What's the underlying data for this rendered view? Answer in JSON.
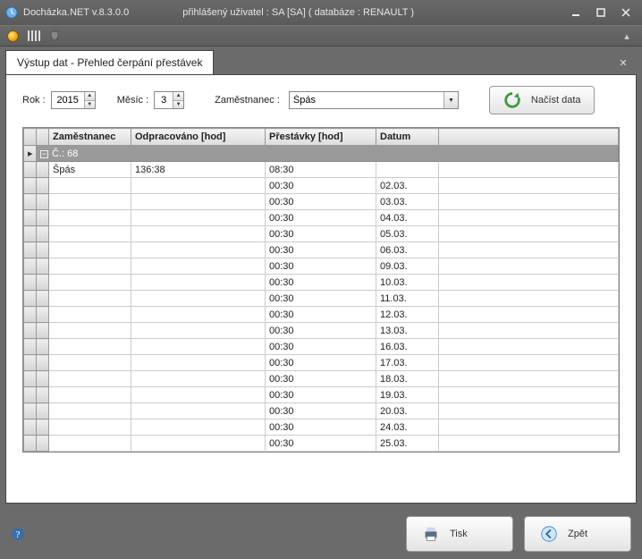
{
  "window": {
    "app_title": "Docházka.NET v.8.3.0.0",
    "user_info": "přihlášený uživatel : SA [SA] ( databáze : RENAULT )"
  },
  "tab": {
    "title": "Výstup dat - Přehled čerpání přestávek"
  },
  "filters": {
    "year_label": "Rok :",
    "year_value": "2015",
    "month_label": "Měsíc :",
    "month_value": "3",
    "employee_label": "Zaměstnanec :",
    "employee_value": "Špás",
    "load_label": "Načíst data"
  },
  "grid": {
    "headers": {
      "employee": "Zaměstnanec",
      "worked": "Odpracováno [hod]",
      "breaks": "Přestávky [hod]",
      "date": "Datum"
    },
    "group_label": "Č.: 68",
    "rows": [
      {
        "employee": "Špás",
        "worked": "136:38",
        "breaks": "08:30",
        "date": ""
      },
      {
        "employee": "",
        "worked": "",
        "breaks": "00:30",
        "date": "02.03."
      },
      {
        "employee": "",
        "worked": "",
        "breaks": "00:30",
        "date": "03.03."
      },
      {
        "employee": "",
        "worked": "",
        "breaks": "00:30",
        "date": "04.03."
      },
      {
        "employee": "",
        "worked": "",
        "breaks": "00:30",
        "date": "05.03."
      },
      {
        "employee": "",
        "worked": "",
        "breaks": "00:30",
        "date": "06.03."
      },
      {
        "employee": "",
        "worked": "",
        "breaks": "00:30",
        "date": "09.03."
      },
      {
        "employee": "",
        "worked": "",
        "breaks": "00:30",
        "date": "10.03."
      },
      {
        "employee": "",
        "worked": "",
        "breaks": "00:30",
        "date": "11.03."
      },
      {
        "employee": "",
        "worked": "",
        "breaks": "00:30",
        "date": "12.03."
      },
      {
        "employee": "",
        "worked": "",
        "breaks": "00:30",
        "date": "13.03."
      },
      {
        "employee": "",
        "worked": "",
        "breaks": "00:30",
        "date": "16.03."
      },
      {
        "employee": "",
        "worked": "",
        "breaks": "00:30",
        "date": "17.03."
      },
      {
        "employee": "",
        "worked": "",
        "breaks": "00:30",
        "date": "18.03."
      },
      {
        "employee": "",
        "worked": "",
        "breaks": "00:30",
        "date": "19.03."
      },
      {
        "employee": "",
        "worked": "",
        "breaks": "00:30",
        "date": "20.03."
      },
      {
        "employee": "",
        "worked": "",
        "breaks": "00:30",
        "date": "24.03."
      },
      {
        "employee": "",
        "worked": "",
        "breaks": "00:30",
        "date": "25.03."
      }
    ]
  },
  "footer": {
    "print_label": "Tisk",
    "back_label": "Zpět"
  }
}
